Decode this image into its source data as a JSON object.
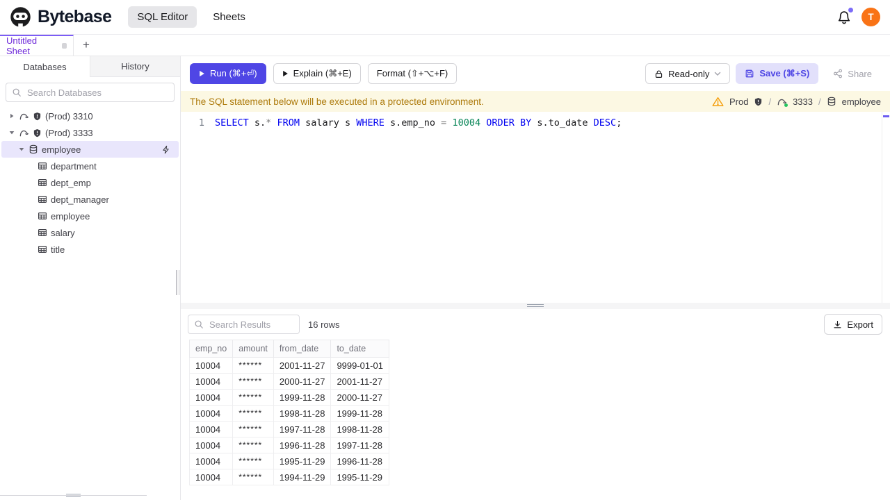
{
  "colors": {
    "accent": "#4f46e5",
    "sheet_purple": "#6d28d9",
    "avatar_orange": "#f97316",
    "banner_bg": "#fcf8e3",
    "banner_text": "#ad7a0b",
    "keyword_blue": "#0000f0",
    "number_green": "#098658",
    "status_green": "#22c55e"
  },
  "header": {
    "brand": "Bytebase",
    "nav_sql_editor": "SQL Editor",
    "nav_sheets": "Sheets",
    "avatar_initial": "T"
  },
  "sheetbar": {
    "tab_label": "Untitled Sheet",
    "add_label": "+"
  },
  "sidebar": {
    "tab_databases": "Databases",
    "tab_history": "History",
    "search_placeholder": "Search Databases",
    "instances": [
      {
        "label": "(Prod) 3310"
      },
      {
        "label": "(Prod) 3333"
      }
    ],
    "database": "employee",
    "tables": [
      "department",
      "dept_emp",
      "dept_manager",
      "employee",
      "salary",
      "title"
    ]
  },
  "toolbar": {
    "run": "Run (⌘+⏎)",
    "explain": "Explain (⌘+E)",
    "format": "Format (⇧+⌥+F)",
    "readonly": "Read-only",
    "save": "Save (⌘+S)",
    "share": "Share"
  },
  "banner": {
    "message": "The SQL statement below will be executed in a protected environment.",
    "env": "Prod",
    "sep1": "/",
    "instance": "3333",
    "sep2": "/",
    "database": "employee"
  },
  "editor": {
    "line_number": "1",
    "tokens": [
      {
        "t": "SELECT",
        "c": "kw"
      },
      {
        "t": " s.",
        "c": "id"
      },
      {
        "t": "*",
        "c": "op"
      },
      {
        "t": " ",
        "c": "id"
      },
      {
        "t": "FROM",
        "c": "kw"
      },
      {
        "t": " salary s ",
        "c": "id"
      },
      {
        "t": "WHERE",
        "c": "kw"
      },
      {
        "t": " s.emp_no ",
        "c": "id"
      },
      {
        "t": "=",
        "c": "op"
      },
      {
        "t": " ",
        "c": "id"
      },
      {
        "t": "10004",
        "c": "num"
      },
      {
        "t": " ",
        "c": "id"
      },
      {
        "t": "ORDER BY",
        "c": "kw"
      },
      {
        "t": " s.to_date ",
        "c": "id"
      },
      {
        "t": "DESC",
        "c": "kw"
      },
      {
        "t": ";",
        "c": "id"
      }
    ]
  },
  "results": {
    "search_placeholder": "Search Results",
    "row_count": "16 rows",
    "export": "Export",
    "columns": [
      "emp_no",
      "amount",
      "from_date",
      "to_date"
    ],
    "rows": [
      [
        "10004",
        "******",
        "2001-11-27",
        "9999-01-01"
      ],
      [
        "10004",
        "******",
        "2000-11-27",
        "2001-11-27"
      ],
      [
        "10004",
        "******",
        "1999-11-28",
        "2000-11-27"
      ],
      [
        "10004",
        "******",
        "1998-11-28",
        "1999-11-28"
      ],
      [
        "10004",
        "******",
        "1997-11-28",
        "1998-11-28"
      ],
      [
        "10004",
        "******",
        "1996-11-28",
        "1997-11-28"
      ],
      [
        "10004",
        "******",
        "1995-11-29",
        "1996-11-28"
      ],
      [
        "10004",
        "******",
        "1994-11-29",
        "1995-11-29"
      ]
    ]
  }
}
